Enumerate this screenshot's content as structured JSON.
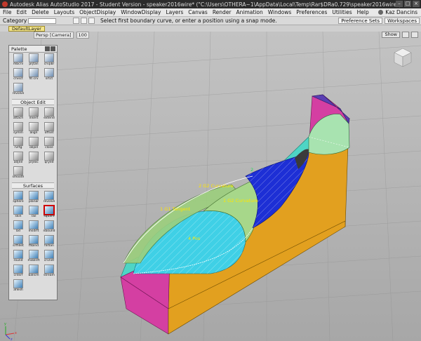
{
  "window": {
    "title": "Autodesk Alias AutoStudio 2017 - Student Version - speaker2016wire* (\"C:\\Users\\OTHERA~1\\AppData\\Local\\Temp\\Rar$DRa0.729\\speaker2016wire\")",
    "controls": [
      "–",
      "□",
      "×"
    ]
  },
  "menu": {
    "items": [
      "File",
      "Edit",
      "Delete",
      "Layouts",
      "ObjectDisplay",
      "WindowDisplay",
      "Layers",
      "Canvas",
      "Render",
      "Animation",
      "Windows",
      "Preferences",
      "Utilities",
      "Help"
    ],
    "user": "Kaz Dancins"
  },
  "toolbar": {
    "category_label": "Category",
    "prompt": "Select first boundary curve, or enter a position using a snap mode.",
    "preference_sets": "Preference Sets",
    "workspaces": "Workspaces"
  },
  "layers": {
    "active": "DefaultLayer"
  },
  "viewport": {
    "camera_label": "Persp [Camera]",
    "zoom_label": "100",
    "show_button": "Show",
    "axis_labels": [
      "x",
      "y",
      "z"
    ],
    "background_top": "#bdbdbd",
    "background_bottom": "#a9a9a9",
    "annotations": [
      {
        "id": "g2-left",
        "text": "2 G2 Curvature",
        "color": "#ffe600"
      },
      {
        "id": "g2-right",
        "text": "1 G2 Curvature",
        "color": "#ffe600"
      },
      {
        "id": "g1-tangent",
        "text": "1 G1 Tangent",
        "color": "#ffe600"
      },
      {
        "id": "g0",
        "text": "4 Pos",
        "color": "#ffe600"
      },
      {
        "id": "blue-marker",
        "text": "2",
        "color": "#22dd55"
      }
    ],
    "surface_colors": {
      "hull_side": "#e4a21e",
      "hull_top": "#4fd6c8",
      "bow_face": "#d63fa4",
      "blue_patch": "#1c2fd6",
      "green_patch": "#9bd07e",
      "cyan_patch": "#3fd1e8",
      "mast_face": "#d63fa4",
      "mast_edge": "#5b3fb4"
    }
  },
  "palette": {
    "title": "Palette",
    "sections": [
      {
        "name": "",
        "tools": [
          {
            "label": "mbcrv",
            "icon": "curve-icon"
          },
          {
            "label": "prjtan",
            "icon": "curve-icon"
          },
          {
            "label": "crvpbr",
            "icon": "curve-icon"
          },
          {
            "label": "crvsct",
            "icon": "curve-icon"
          },
          {
            "label": "fit crv",
            "icon": "curve-icon"
          },
          {
            "label": "srtct",
            "icon": "curve-icon"
          },
          {
            "label": "revolve",
            "icon": "curve-icon"
          }
        ]
      },
      {
        "name": "Object Edit",
        "tools": [
          {
            "label": "attach",
            "icon": "edit-icon"
          },
          {
            "label": "insert",
            "icon": "edit-icon"
          },
          {
            "label": "extend",
            "icon": "edit-icon"
          },
          {
            "label": "symm",
            "icon": "edit-icon"
          },
          {
            "label": "align",
            "icon": "edit-icon"
          },
          {
            "label": "offset",
            "icon": "edit-icon"
          },
          {
            "label": "rvrtg",
            "icon": "edit-icon"
          },
          {
            "label": "objsd",
            "icon": "edit-icon"
          },
          {
            "label": "close",
            "icon": "edit-icon"
          },
          {
            "label": "adjne",
            "icon": "edit-icon"
          },
          {
            "label": "prjexc",
            "icon": "edit-icon"
          },
          {
            "label": "qryed",
            "icon": "edit-icon"
          },
          {
            "label": "smooth",
            "icon": "edit-icon"
          }
        ]
      },
      {
        "name": "Surfaces",
        "tools": [
          {
            "label": "sphere",
            "icon": "surface-icon"
          },
          {
            "label": "planar",
            "icon": "surface-icon"
          },
          {
            "label": "revolve",
            "icon": "surface-icon"
          },
          {
            "label": "skin",
            "icon": "surface-icon"
          },
          {
            "label": "rail",
            "icon": "surface-icon"
          },
          {
            "label": "square",
            "icon": "surface-icon",
            "selected": true
          },
          {
            "label": "bd",
            "icon": "surface-icon"
          },
          {
            "label": "msdrft",
            "icon": "surface-icon"
          },
          {
            "label": "nbound",
            "icon": "surface-icon"
          },
          {
            "label": "srffillet",
            "icon": "surface-icon"
          },
          {
            "label": "fflblnd",
            "icon": "surface-icon"
          },
          {
            "label": "fillflan",
            "icon": "surface-icon"
          },
          {
            "label": "round",
            "icon": "surface-icon"
          },
          {
            "label": "msblnft",
            "icon": "surface-icon"
          },
          {
            "label": "crvnet",
            "icon": "surface-icon"
          },
          {
            "label": "crdsrf",
            "icon": "surface-icon"
          },
          {
            "label": "ballcm",
            "icon": "surface-icon"
          },
          {
            "label": "stream",
            "icon": "surface-icon"
          },
          {
            "label": "aflesh",
            "icon": "surface-icon"
          }
        ]
      }
    ]
  }
}
